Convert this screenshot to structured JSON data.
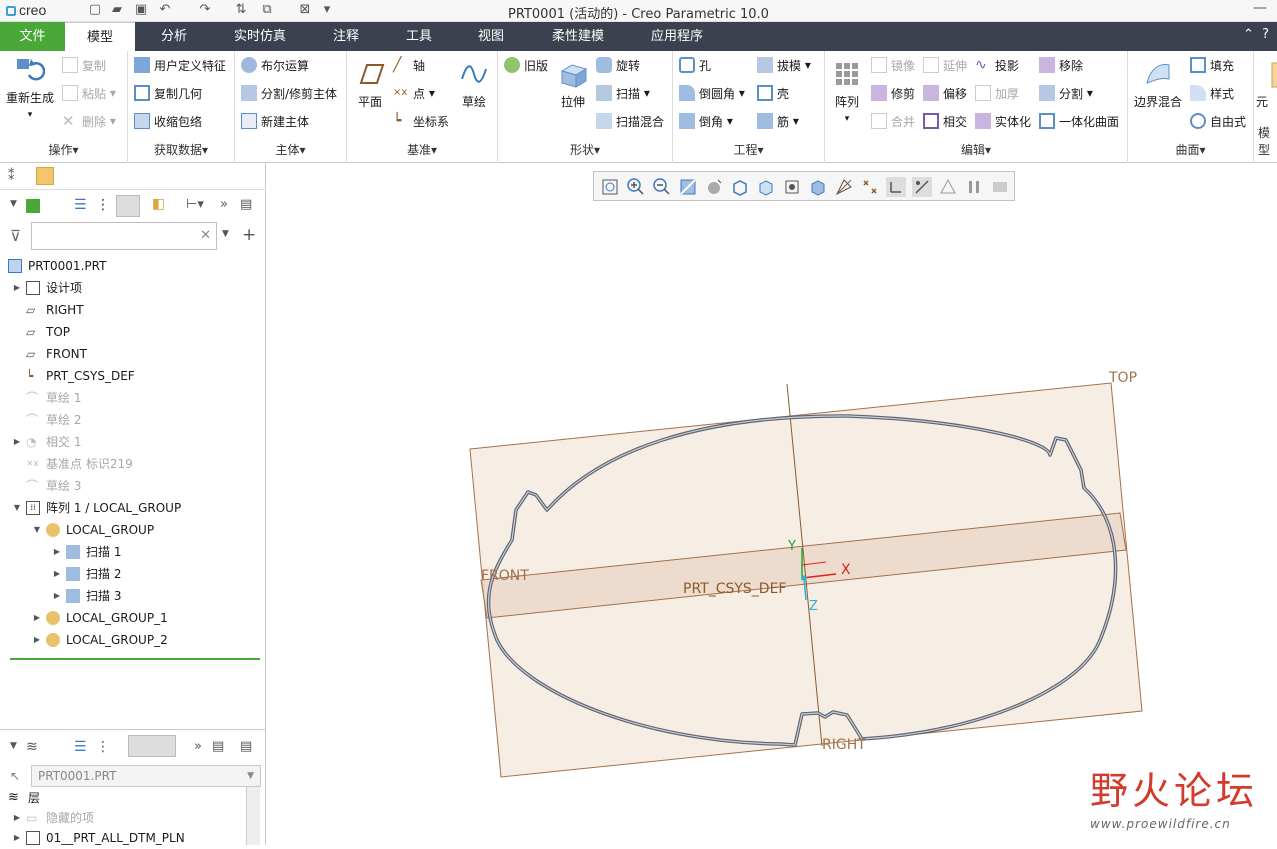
{
  "app": {
    "logo": "creo",
    "title": "PRT0001 (活动的) - Creo Parametric 10.0"
  },
  "tabs": [
    "文件",
    "模型",
    "分析",
    "实时仿真",
    "注释",
    "工具",
    "视图",
    "柔性建模",
    "应用程序"
  ],
  "ribbon": {
    "operations": {
      "regenerate": "重新生成",
      "copy": "复制",
      "paste": "粘贴",
      "delete": "删除",
      "label": "操作"
    },
    "get_data": {
      "udf": "用户定义特征",
      "copy_geom": "复制几何",
      "shrinkwrap": "收缩包络",
      "label": "获取数据"
    },
    "body": {
      "boolean": "布尔运算",
      "split_trim": "分割/修剪主体",
      "new_body": "新建主体",
      "label": "主体"
    },
    "datum": {
      "plane": "平面",
      "axis": "轴",
      "point": "点",
      "csys": "坐标系",
      "sketch": "草绘",
      "label": "基准"
    },
    "shapes": {
      "legacy": "旧版",
      "extrude": "拉伸",
      "revolve": "旋转",
      "sweep": "扫描",
      "swept_blend": "扫描混合",
      "label": "形状"
    },
    "engineering": {
      "hole": "孔",
      "round": "倒圆角",
      "chamfer": "倒角",
      "draft": "拔模",
      "shell": "壳",
      "rib": "筋",
      "label": "工程"
    },
    "editing": {
      "pattern": "阵列",
      "mirror": "镜像",
      "trim": "修剪",
      "merge": "合并",
      "extend": "延伸",
      "offset": "偏移",
      "intersect": "相交",
      "project": "投影",
      "thicken": "加厚",
      "solidify": "实体化",
      "remove": "移除",
      "split": "分割",
      "unify": "一体化曲面",
      "label": "编辑"
    },
    "surfaces": {
      "boundary_blend": "边界混合",
      "fill": "填充",
      "style": "样式",
      "freestyle": "自由式",
      "label": "曲面"
    },
    "model_intent": {
      "short": "元",
      "label": "模型"
    }
  },
  "model_tree": {
    "filter_placeholder": "",
    "items": [
      {
        "label": "PRT0001.PRT"
      },
      {
        "label": "设计项"
      },
      {
        "label": "RIGHT"
      },
      {
        "label": "TOP"
      },
      {
        "label": "FRONT"
      },
      {
        "label": "PRT_CSYS_DEF"
      },
      {
        "label": "草绘 1"
      },
      {
        "label": "草绘 2"
      },
      {
        "label": "相交 1"
      },
      {
        "label": "基准点 标识219"
      },
      {
        "label": "草绘 3"
      },
      {
        "label": "阵列 1 / LOCAL_GROUP"
      },
      {
        "label": "LOCAL_GROUP"
      },
      {
        "label": "扫描 1"
      },
      {
        "label": "扫描 2"
      },
      {
        "label": "扫描 3"
      },
      {
        "label": "LOCAL_GROUP_1"
      },
      {
        "label": "LOCAL_GROUP_2"
      }
    ]
  },
  "layer_tree": {
    "model_select": "PRT0001.PRT",
    "header": "层",
    "items": [
      {
        "label": "隐藏的项"
      },
      {
        "label": "01__PRT_ALL_DTM_PLN"
      }
    ]
  },
  "graphics": {
    "labels": {
      "top": "TOP",
      "front": "FRONT",
      "right": "RIGHT",
      "csys": "PRT_CSYS_DEF",
      "x": "X",
      "y": "Y",
      "z": "Z"
    }
  },
  "watermark": {
    "text": "野火论坛",
    "url": "www.proewildfire.cn"
  },
  "colors": {
    "file_tab": "#4aa838",
    "tabbar": "#3c4150",
    "datum": "#8b5a2b",
    "plane_fill": "#f3e7dc"
  }
}
